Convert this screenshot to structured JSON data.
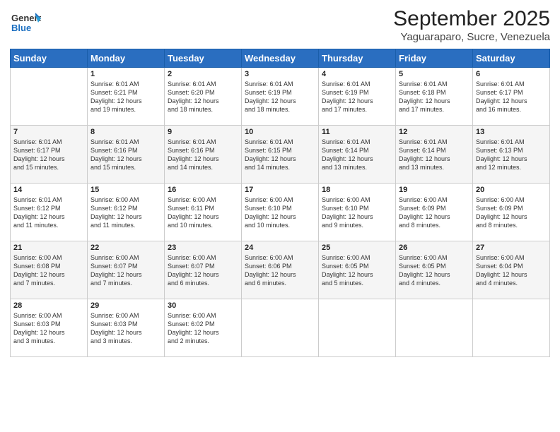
{
  "logo": {
    "general": "General",
    "blue": "Blue"
  },
  "title": "September 2025",
  "subtitle": "Yaguaraparo, Sucre, Venezuela",
  "days_of_week": [
    "Sunday",
    "Monday",
    "Tuesday",
    "Wednesday",
    "Thursday",
    "Friday",
    "Saturday"
  ],
  "weeks": [
    [
      {
        "day": "",
        "info": ""
      },
      {
        "day": "1",
        "info": "Sunrise: 6:01 AM\nSunset: 6:21 PM\nDaylight: 12 hours\nand 19 minutes."
      },
      {
        "day": "2",
        "info": "Sunrise: 6:01 AM\nSunset: 6:20 PM\nDaylight: 12 hours\nand 18 minutes."
      },
      {
        "day": "3",
        "info": "Sunrise: 6:01 AM\nSunset: 6:19 PM\nDaylight: 12 hours\nand 18 minutes."
      },
      {
        "day": "4",
        "info": "Sunrise: 6:01 AM\nSunset: 6:19 PM\nDaylight: 12 hours\nand 17 minutes."
      },
      {
        "day": "5",
        "info": "Sunrise: 6:01 AM\nSunset: 6:18 PM\nDaylight: 12 hours\nand 17 minutes."
      },
      {
        "day": "6",
        "info": "Sunrise: 6:01 AM\nSunset: 6:17 PM\nDaylight: 12 hours\nand 16 minutes."
      }
    ],
    [
      {
        "day": "7",
        "info": "Sunrise: 6:01 AM\nSunset: 6:17 PM\nDaylight: 12 hours\nand 15 minutes."
      },
      {
        "day": "8",
        "info": "Sunrise: 6:01 AM\nSunset: 6:16 PM\nDaylight: 12 hours\nand 15 minutes."
      },
      {
        "day": "9",
        "info": "Sunrise: 6:01 AM\nSunset: 6:16 PM\nDaylight: 12 hours\nand 14 minutes."
      },
      {
        "day": "10",
        "info": "Sunrise: 6:01 AM\nSunset: 6:15 PM\nDaylight: 12 hours\nand 14 minutes."
      },
      {
        "day": "11",
        "info": "Sunrise: 6:01 AM\nSunset: 6:14 PM\nDaylight: 12 hours\nand 13 minutes."
      },
      {
        "day": "12",
        "info": "Sunrise: 6:01 AM\nSunset: 6:14 PM\nDaylight: 12 hours\nand 13 minutes."
      },
      {
        "day": "13",
        "info": "Sunrise: 6:01 AM\nSunset: 6:13 PM\nDaylight: 12 hours\nand 12 minutes."
      }
    ],
    [
      {
        "day": "14",
        "info": "Sunrise: 6:01 AM\nSunset: 6:12 PM\nDaylight: 12 hours\nand 11 minutes."
      },
      {
        "day": "15",
        "info": "Sunrise: 6:00 AM\nSunset: 6:12 PM\nDaylight: 12 hours\nand 11 minutes."
      },
      {
        "day": "16",
        "info": "Sunrise: 6:00 AM\nSunset: 6:11 PM\nDaylight: 12 hours\nand 10 minutes."
      },
      {
        "day": "17",
        "info": "Sunrise: 6:00 AM\nSunset: 6:10 PM\nDaylight: 12 hours\nand 10 minutes."
      },
      {
        "day": "18",
        "info": "Sunrise: 6:00 AM\nSunset: 6:10 PM\nDaylight: 12 hours\nand 9 minutes."
      },
      {
        "day": "19",
        "info": "Sunrise: 6:00 AM\nSunset: 6:09 PM\nDaylight: 12 hours\nand 8 minutes."
      },
      {
        "day": "20",
        "info": "Sunrise: 6:00 AM\nSunset: 6:09 PM\nDaylight: 12 hours\nand 8 minutes."
      }
    ],
    [
      {
        "day": "21",
        "info": "Sunrise: 6:00 AM\nSunset: 6:08 PM\nDaylight: 12 hours\nand 7 minutes."
      },
      {
        "day": "22",
        "info": "Sunrise: 6:00 AM\nSunset: 6:07 PM\nDaylight: 12 hours\nand 7 minutes."
      },
      {
        "day": "23",
        "info": "Sunrise: 6:00 AM\nSunset: 6:07 PM\nDaylight: 12 hours\nand 6 minutes."
      },
      {
        "day": "24",
        "info": "Sunrise: 6:00 AM\nSunset: 6:06 PM\nDaylight: 12 hours\nand 6 minutes."
      },
      {
        "day": "25",
        "info": "Sunrise: 6:00 AM\nSunset: 6:05 PM\nDaylight: 12 hours\nand 5 minutes."
      },
      {
        "day": "26",
        "info": "Sunrise: 6:00 AM\nSunset: 6:05 PM\nDaylight: 12 hours\nand 4 minutes."
      },
      {
        "day": "27",
        "info": "Sunrise: 6:00 AM\nSunset: 6:04 PM\nDaylight: 12 hours\nand 4 minutes."
      }
    ],
    [
      {
        "day": "28",
        "info": "Sunrise: 6:00 AM\nSunset: 6:03 PM\nDaylight: 12 hours\nand 3 minutes."
      },
      {
        "day": "29",
        "info": "Sunrise: 6:00 AM\nSunset: 6:03 PM\nDaylight: 12 hours\nand 3 minutes."
      },
      {
        "day": "30",
        "info": "Sunrise: 6:00 AM\nSunset: 6:02 PM\nDaylight: 12 hours\nand 2 minutes."
      },
      {
        "day": "",
        "info": ""
      },
      {
        "day": "",
        "info": ""
      },
      {
        "day": "",
        "info": ""
      },
      {
        "day": "",
        "info": ""
      }
    ]
  ]
}
